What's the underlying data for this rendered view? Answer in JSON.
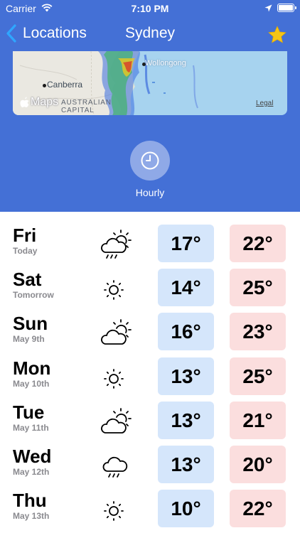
{
  "status_bar": {
    "carrier": "Carrier",
    "time": "7:10 PM"
  },
  "nav": {
    "back_label": "Locations",
    "title": "Sydney"
  },
  "map": {
    "labels": {
      "canberra": "Canberra",
      "wollongong": "Wollongong",
      "capital": "AUSTRALIAN CAPITAL"
    },
    "logo_text": "Maps",
    "legal": "Legal"
  },
  "hourly": {
    "label": "Hourly"
  },
  "forecast": [
    {
      "day": "Fri",
      "sub": "Today",
      "icon": "partly-cloudy-rain-icon",
      "low": "17°",
      "high": "22°"
    },
    {
      "day": "Sat",
      "sub": "Tomorrow",
      "icon": "sun-icon",
      "low": "14°",
      "high": "25°"
    },
    {
      "day": "Sun",
      "sub": "May 9th",
      "icon": "partly-cloudy-icon",
      "low": "16°",
      "high": "23°"
    },
    {
      "day": "Mon",
      "sub": "May 10th",
      "icon": "sun-icon",
      "low": "13°",
      "high": "25°"
    },
    {
      "day": "Tue",
      "sub": "May 11th",
      "icon": "partly-cloudy-icon",
      "low": "13°",
      "high": "21°"
    },
    {
      "day": "Wed",
      "sub": "May 12th",
      "icon": "cloud-rain-icon",
      "low": "13°",
      "high": "20°"
    },
    {
      "day": "Thu",
      "sub": "May 13th",
      "icon": "sun-icon",
      "low": "10°",
      "high": "22°"
    }
  ],
  "colors": {
    "header": "#4470d6",
    "low_bg": "#d5e6fb",
    "high_bg": "#fbdede",
    "star": "#f5c518"
  }
}
